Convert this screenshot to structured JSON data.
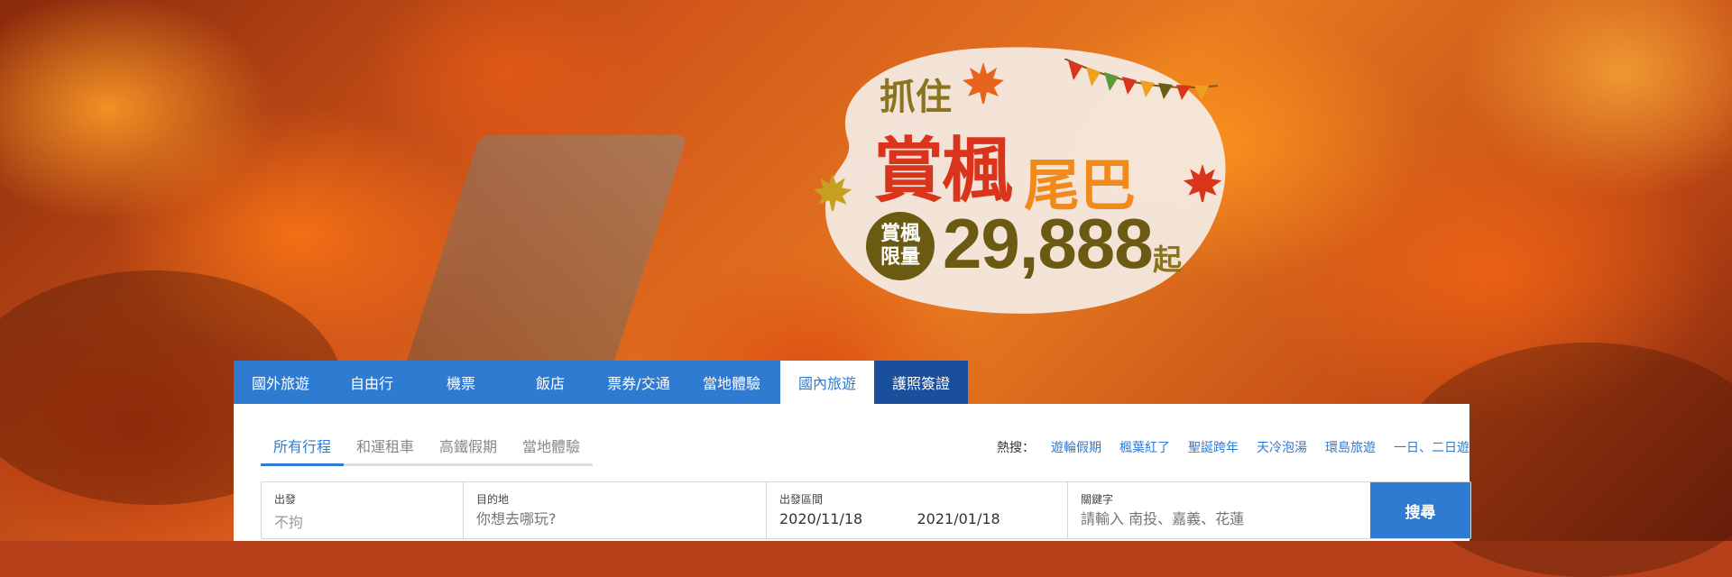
{
  "promo": {
    "line1": "抓住",
    "line2a": "賞楓",
    "line2b": "尾巴",
    "badge_top": "賞楓",
    "badge_bottom": "限量",
    "price": "29,888",
    "price_suffix": "起"
  },
  "tabs": [
    {
      "label": "國外旅遊"
    },
    {
      "label": "自由行"
    },
    {
      "label": "機票"
    },
    {
      "label": "飯店"
    },
    {
      "label": "票券/交通"
    },
    {
      "label": "當地體驗"
    },
    {
      "label": "國內旅遊"
    },
    {
      "label": "護照簽證"
    }
  ],
  "subtabs": [
    {
      "label": "所有行程"
    },
    {
      "label": "和運租車"
    },
    {
      "label": "高鐵假期"
    },
    {
      "label": "當地體驗"
    }
  ],
  "hot": {
    "label": "熱搜：",
    "items": [
      "遊輪假期",
      "楓葉紅了",
      "聖誕跨年",
      "天冷泡湯",
      "環島旅遊",
      "一日、二日遊"
    ]
  },
  "search": {
    "depart_label": "出發",
    "depart_value": "不拘",
    "dest_label": "目的地",
    "dest_placeholder": "你想去哪玩?",
    "date_label": "出發區間",
    "date_from": "2020/11/18",
    "date_to": "2021/01/18",
    "keyword_label": "關鍵字",
    "keyword_placeholder": "請輸入 南投、嘉義、花蓮",
    "button": "搜尋"
  },
  "colors": {
    "accent": "#2f7bd2",
    "dark_tab": "#1a4f9c",
    "promo_red": "#d9341c",
    "promo_olive": "#6b5a12"
  }
}
